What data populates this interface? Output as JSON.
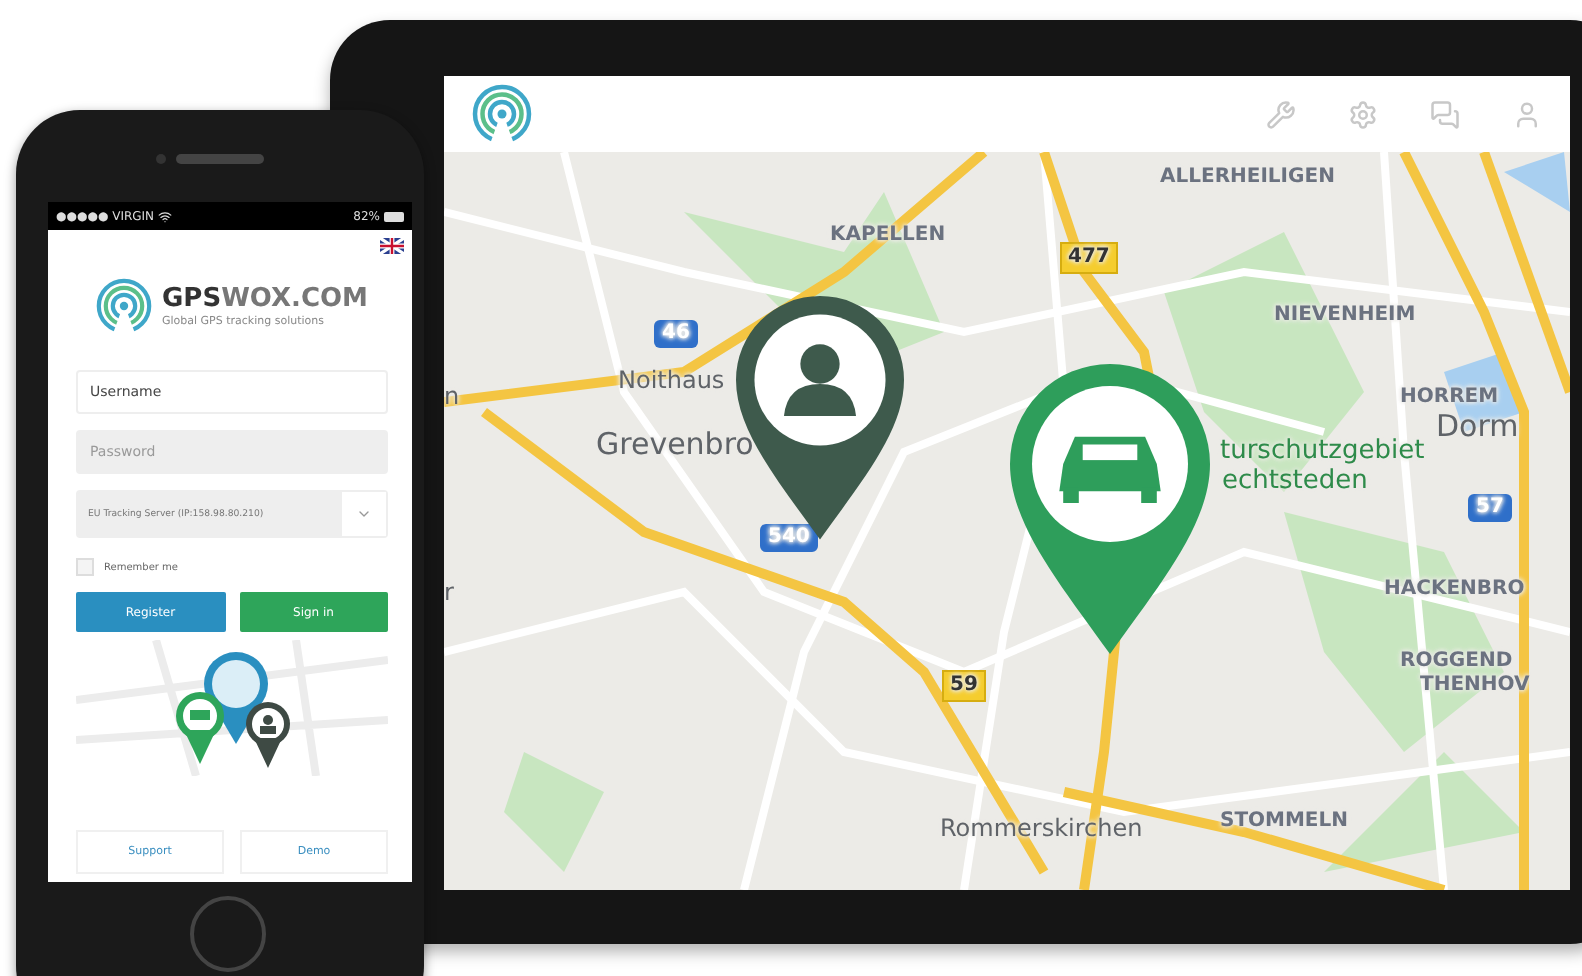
{
  "tablet": {
    "map": {
      "labels": [
        {
          "text": "ALLERHEILIGEN",
          "kind": "place"
        },
        {
          "text": "KAPELLEN",
          "kind": "place"
        },
        {
          "text": "477",
          "kind": "road-yellow"
        },
        {
          "text": "46",
          "kind": "road-blue"
        },
        {
          "text": "NIEVENHEIM",
          "kind": "place"
        },
        {
          "text": "Noithaus",
          "kind": "town-small"
        },
        {
          "text": "n",
          "kind": "town-small"
        },
        {
          "text": "Grevenbro",
          "kind": "town"
        },
        {
          "text": "HORREM",
          "kind": "place"
        },
        {
          "text": "Dorm",
          "kind": "town"
        },
        {
          "text": "turschutzgebiet",
          "kind": "park"
        },
        {
          "text": "echtsteden",
          "kind": "park"
        },
        {
          "text": "540",
          "kind": "road-blue"
        },
        {
          "text": "57",
          "kind": "road-blue"
        },
        {
          "text": "r",
          "kind": "town-small"
        },
        {
          "text": "HACKENBRO",
          "kind": "place"
        },
        {
          "text": "ROGGEND",
          "kind": "place"
        },
        {
          "text": "THENHOV",
          "kind": "place"
        },
        {
          "text": "59",
          "kind": "road-yellow"
        },
        {
          "text": "Rommerskirchen",
          "kind": "town-small"
        },
        {
          "text": "STOMMELN",
          "kind": "place"
        }
      ],
      "pins": [
        {
          "kind": "person",
          "color": "#3e5a4c"
        },
        {
          "kind": "car",
          "color": "#2e9e5b"
        }
      ]
    }
  },
  "phone": {
    "status": {
      "carrier": "●●●●● VIRGIN",
      "battery": "82%"
    },
    "brand": {
      "name": "**GPS**WOX.COM",
      "tagline": "Global GPS tracking solutions"
    },
    "username": {
      "placeholder": "Username"
    },
    "password": {
      "placeholder": "Password"
    },
    "server": {
      "value": "EU Tracking Server (IP:158.98.80.210)"
    },
    "remember": {
      "label": "Remember me",
      "checked": false
    },
    "buttons": [
      {
        "label": "Register",
        "kind": "blue"
      },
      {
        "label": "Sign in",
        "kind": "green"
      }
    ],
    "links": [
      "Support",
      "Demo"
    ]
  }
}
